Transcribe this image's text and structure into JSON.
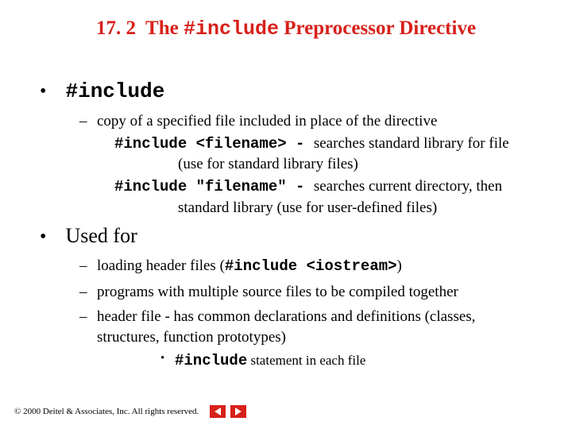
{
  "title": {
    "section": "17. 2",
    "pre": "The",
    "mono": "#include",
    "post": "Preprocessor Directive"
  },
  "bullets": [
    {
      "label_mono": "#include",
      "sub": [
        {
          "text": "copy of a specified file included in place of the directive",
          "details": [
            {
              "mono": "#include <filename>",
              "dash": " - ",
              "rest": "searches standard library for file",
              "indent": "(use for standard library files)"
            },
            {
              "mono": "#include \"filename\"",
              "dash": " - ",
              "rest": "searches current directory, then",
              "indent": "standard library (use for user-defined files)"
            }
          ]
        }
      ]
    },
    {
      "label": "Used for",
      "sub": [
        {
          "pre": "loading header files (",
          "mono": "#include <iostream>",
          "post": ")"
        },
        {
          "text": "programs with multiple source files to be compiled together"
        },
        {
          "text": "header file - has common declarations and definitions (classes, structures, function prototypes)",
          "sub3": [
            {
              "mono": "#include",
              "rest": " statement in each file"
            }
          ]
        }
      ]
    }
  ],
  "footer": {
    "copyright": "© 2000 Deitel & Associates, Inc.  All rights reserved."
  }
}
